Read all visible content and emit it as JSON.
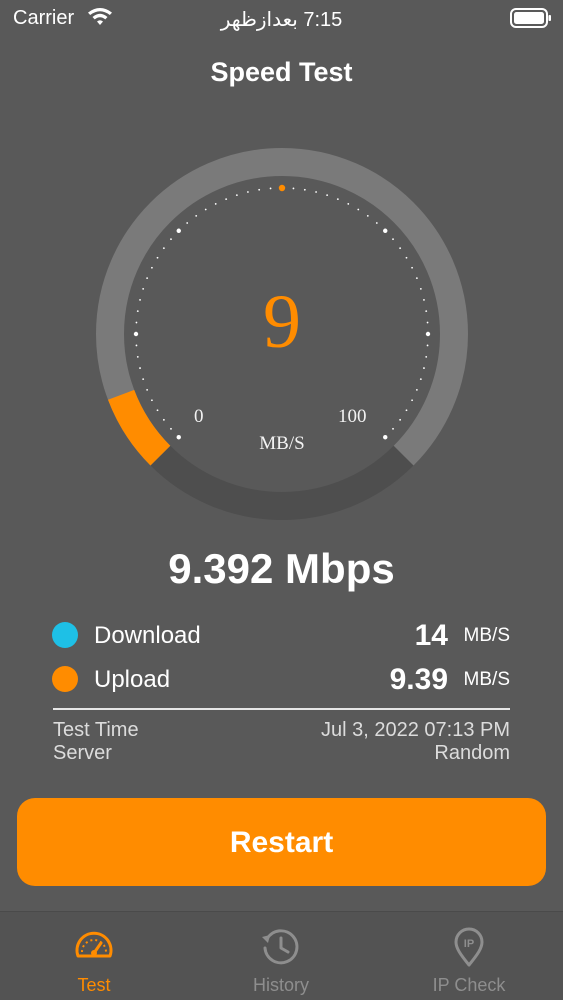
{
  "status_bar": {
    "carrier": "Carrier",
    "time": "7:15 بعدازظهر",
    "icons": [
      "wifi-icon",
      "battery-icon"
    ]
  },
  "header": {
    "title": "Speed Test"
  },
  "gauge": {
    "value": "9",
    "min_label": "0",
    "max_label": "100",
    "unit": "MB/S",
    "fill_fraction": 0.09,
    "colors": {
      "fill": "#ff8c00",
      "track": "#7a7a7a",
      "track_dark": "#4e4e4e",
      "needle_dot": "#ff8c00"
    }
  },
  "speed": {
    "value": "9.392 Mbps"
  },
  "results": [
    {
      "label": "Download",
      "value": "14",
      "unit": "MB/S",
      "dot_color": "#1ec0e6"
    },
    {
      "label": "Upload",
      "value": "9.39",
      "unit": "MB/S",
      "dot_color": "#ff8c00"
    }
  ],
  "info": {
    "labels": [
      "Test Time",
      "Server"
    ],
    "values": [
      "Jul 3, 2022 07:13 PM",
      "Random"
    ]
  },
  "actions": {
    "restart_label": "Restart"
  },
  "tab_bar": {
    "tabs": [
      {
        "label": "Test",
        "icon": "speedometer-icon",
        "active": true
      },
      {
        "label": "History",
        "icon": "history-icon",
        "active": false
      },
      {
        "label": "IP Check",
        "icon": "ip-location-icon",
        "active": false
      }
    ],
    "active_color": "#ff8c00",
    "inactive_color": "#8e8e8e"
  }
}
